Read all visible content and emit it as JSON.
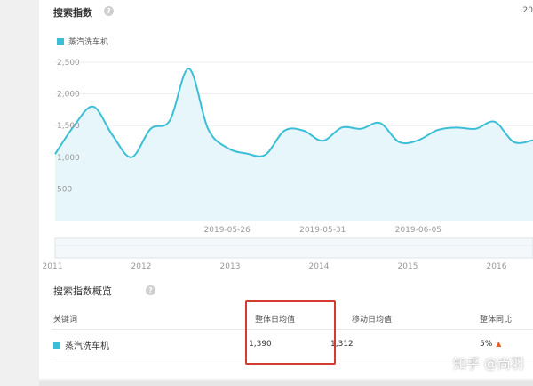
{
  "panel": {
    "title": "搜索指数",
    "help": "?",
    "year_cut": "20"
  },
  "legend": {
    "label": "蒸汽洗车机",
    "color": "#3cbfd6"
  },
  "chart_data": {
    "type": "area",
    "series": [
      {
        "name": "蒸汽洗车机",
        "x": [
          "2019-05-17",
          "2019-05-18",
          "2019-05-19",
          "2019-05-20",
          "2019-05-21",
          "2019-05-22",
          "2019-05-23",
          "2019-05-24",
          "2019-05-25",
          "2019-05-26",
          "2019-05-27",
          "2019-05-28",
          "2019-05-29",
          "2019-05-30",
          "2019-05-31",
          "2019-06-01",
          "2019-06-02",
          "2019-06-03",
          "2019-06-04",
          "2019-06-05",
          "2019-06-06",
          "2019-06-07",
          "2019-06-08",
          "2019-06-09",
          "2019-06-10",
          "2019-06-11"
        ],
        "values": [
          1050,
          1500,
          1800,
          1350,
          1000,
          1450,
          1580,
          2400,
          1450,
          1150,
          1060,
          1040,
          1420,
          1420,
          1260,
          1470,
          1450,
          1540,
          1240,
          1270,
          1430,
          1470,
          1450,
          1560,
          1240,
          1270
        ]
      }
    ],
    "ylim": [
      0,
      2500
    ],
    "y_ticks": [
      "2,500",
      "2,000",
      "1,500",
      "1,000",
      "500"
    ],
    "x_ticks": [
      "2019-05-26",
      "2019-05-31",
      "2019-06-05"
    ],
    "timeline_years": [
      "2011",
      "2012",
      "2013",
      "2014",
      "2015",
      "2016"
    ],
    "grid": true,
    "legend_position": "top-left",
    "line_color": "#3cbfd6",
    "fill_color": "#e7f6fa"
  },
  "summary": {
    "title": "搜索指数概览",
    "help": "?",
    "headers": {
      "keyword": "关键词",
      "overall_avg": "整体日均值",
      "mobile_avg": "移动日均值",
      "overall_yoy": "整体同比"
    },
    "row": {
      "keyword": "蒸汽洗车机",
      "overall_avg": "1,390",
      "mobile_avg": "1,312",
      "overall_yoy": "5%",
      "trend_icon": "up-arrow-icon"
    }
  },
  "watermark": "知乎 @尚羽",
  "colors": {
    "highlight": "#d23b32",
    "accent": "#3cbfd6"
  }
}
